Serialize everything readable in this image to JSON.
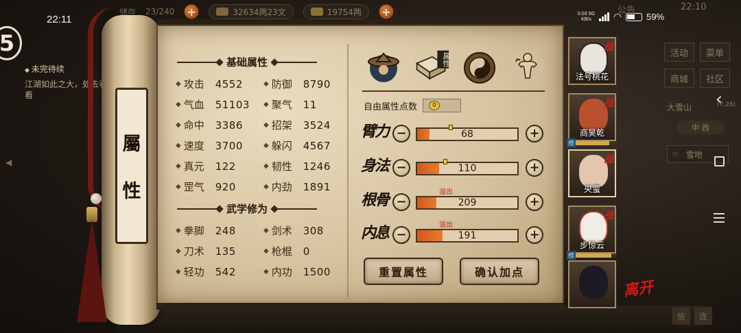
{
  "status_bar": {
    "time": "22:11",
    "net_speed": "0.03 5G",
    "net_unit": "KB/s",
    "battery": "59%"
  },
  "hud": {
    "cut_label": "储存",
    "capacity": "23/240",
    "silver": "32634两23文",
    "gold": "19754两",
    "notice": "公告",
    "game_clock": "22:10"
  },
  "quest": {
    "badge": "5",
    "title": "未完待续",
    "desc": "江湖如此之大，处去看看"
  },
  "side_menu": {
    "items": [
      "活动",
      "菜单",
      "商城",
      "社区"
    ],
    "region": "大雪山",
    "region_coord": "(7,28)",
    "region_tab": "中 西",
    "location": "雪地",
    "bottom_chips": [
      "信",
      "连"
    ]
  },
  "scroll": {
    "label_top": "屬",
    "label_bottom": "性"
  },
  "basic": {
    "title": "基础属性",
    "stats": [
      {
        "label": "攻击",
        "value": "4552"
      },
      {
        "label": "防御",
        "value": "8790"
      },
      {
        "label": "气血",
        "value": "51103"
      },
      {
        "label": "聚气",
        "value": "11"
      },
      {
        "label": "命中",
        "value": "3386"
      },
      {
        "label": "招架",
        "value": "3524"
      },
      {
        "label": "速度",
        "value": "3700"
      },
      {
        "label": "躲闪",
        "value": "4567"
      },
      {
        "label": "真元",
        "value": "122"
      },
      {
        "label": "韧性",
        "value": "1246"
      },
      {
        "label": "罡气",
        "value": "920"
      },
      {
        "label": "内劲",
        "value": "1891"
      }
    ]
  },
  "martial": {
    "title": "武学修为",
    "stats": [
      {
        "label": "拳脚",
        "value": "248"
      },
      {
        "label": "剑术",
        "value": "308"
      },
      {
        "label": "刀术",
        "value": "135"
      },
      {
        "label": "枪棍",
        "value": "0"
      },
      {
        "label": "轻功",
        "value": "542"
      },
      {
        "label": "内功",
        "value": "1500"
      }
    ]
  },
  "tabs": {
    "attr_tab_label": "属性"
  },
  "free_points": {
    "label": "自由属性点数",
    "value": "0"
  },
  "attributes": [
    {
      "name": "臂力",
      "value": "68",
      "fill": 0.12,
      "overflow": ""
    },
    {
      "name": "身法",
      "value": "110",
      "fill": 0.22,
      "overflow": ""
    },
    {
      "name": "根骨",
      "value": "209",
      "fill": 0.19,
      "overflow": "溢出"
    },
    {
      "name": "内息",
      "value": "191",
      "fill": 0.25,
      "overflow": "溢出"
    }
  ],
  "buttons": {
    "reset": "重置属性",
    "confirm": "确认加点",
    "leave": "离开"
  },
  "roster": [
    {
      "name": "法号桃花",
      "battle": "战",
      "level": 0.0,
      "tag": ""
    },
    {
      "name": "商昊乾",
      "battle": "战",
      "level": 0.85,
      "tag": "修"
    },
    {
      "name": "央蛮",
      "battle": "战",
      "level": 0.0,
      "tag": ""
    },
    {
      "name": "步惊云",
      "battle": "战",
      "level": 0.9,
      "tag": "修"
    },
    {
      "name": "",
      "battle": "",
      "level": 0.0,
      "tag": ""
    }
  ],
  "colors": {
    "bar_fill": "#e0692a",
    "battle_red": "#d21e18",
    "parchment": "#e2d3b3"
  }
}
